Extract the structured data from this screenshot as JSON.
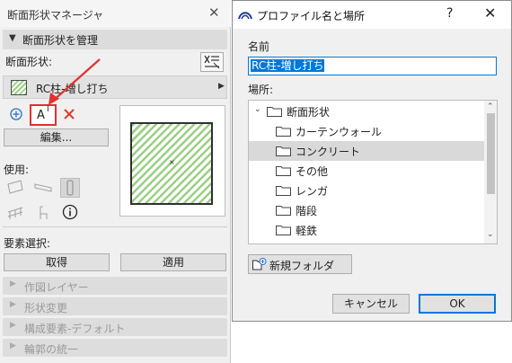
{
  "panel": {
    "title": "断面形状マネージャ",
    "section_title": "断面形状を管理",
    "profile_label": "断面形状:",
    "profile_value": "RC柱-増し打ち",
    "edit_button": "編集...",
    "use_label": "使用:",
    "element_select_label": "要素選択:",
    "get_button": "取得",
    "apply_button": "適用",
    "collapsed_sections": [
      "作図レイヤー",
      "形状変更",
      "構成要素-デフォルト",
      "輪郭の統一"
    ]
  },
  "dialog": {
    "title": "プロファイル名と場所",
    "name_label": "名前",
    "name_value": "RC柱-増し打ち",
    "location_label": "場所:",
    "tree": {
      "root": "断面形状",
      "children": [
        "カーテンウォール",
        "コンクリート",
        "その他",
        "レンガ",
        "階段",
        "軽鉄"
      ],
      "selected": "コンクリート"
    },
    "new_folder_button": "新規フォルダ",
    "cancel_button": "キャンセル",
    "ok_button": "OK"
  },
  "colors": {
    "accent_blue": "#0078d7",
    "highlight_red": "#e23030",
    "hatch_green": "#9bcf84"
  }
}
